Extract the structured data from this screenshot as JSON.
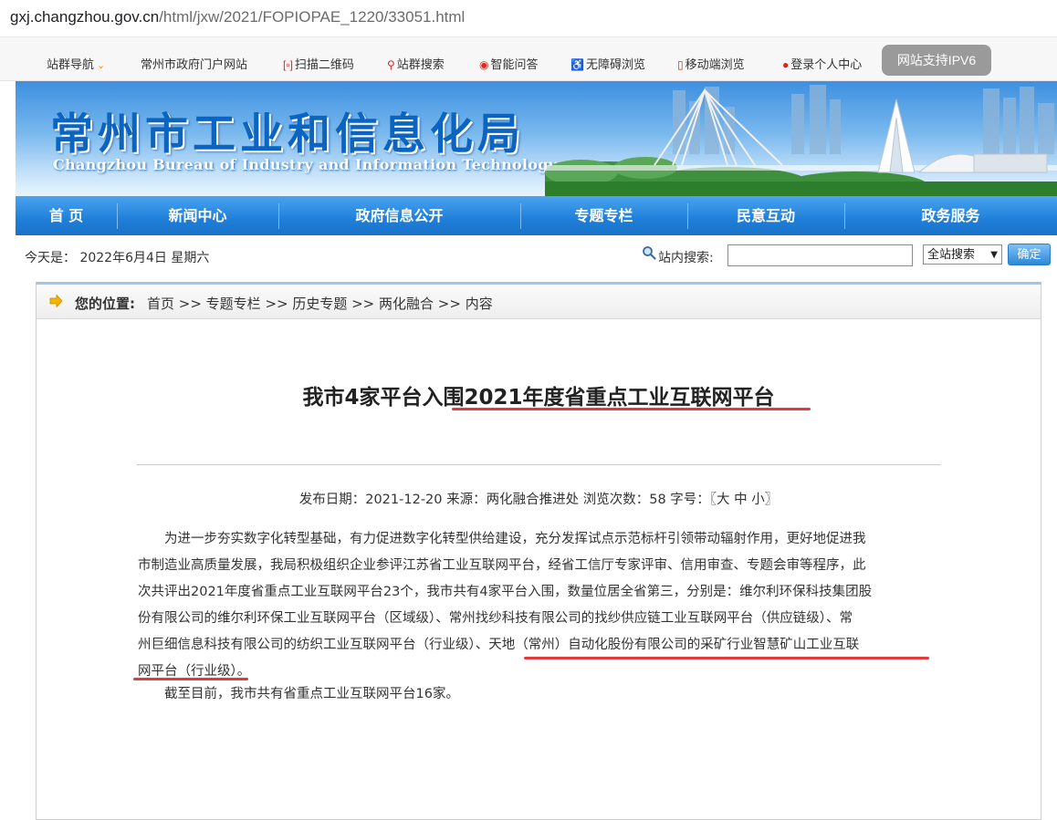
{
  "browser": {
    "url_host": "gxj.changzhou.gov.cn",
    "url_path": "/html/jxw/2021/FOPIOPAE_1220/33051.html"
  },
  "topbar": {
    "items": [
      {
        "label": "站群导航",
        "icon": "chevron-down"
      },
      {
        "label": "常州市政府门户网站",
        "icon": ""
      },
      {
        "label": "扫描二维码",
        "icon": "qr-icon"
      },
      {
        "label": "站群搜索",
        "icon": "search-icon"
      },
      {
        "label": "智能问答",
        "icon": "robot-icon"
      },
      {
        "label": "无障碍浏览",
        "icon": "accessibility-icon"
      },
      {
        "label": "移动端浏览",
        "icon": "mobile-icon"
      },
      {
        "label": "登录个人中心",
        "icon": "user-icon"
      }
    ],
    "ipv6_badge": "网站支持IPV6"
  },
  "header": {
    "title": "常州市工业和信息化局",
    "subtitle": "Changzhou Bureau of Industry and Information Technology"
  },
  "nav": {
    "items": [
      "首 页",
      "新闻中心",
      "政府信息公开",
      "专题专栏",
      "民意互动",
      "政务服务"
    ]
  },
  "date_row": {
    "today": "今天是： 2022年6月4日 星期六",
    "search_label": "站内搜索:",
    "search_value": "",
    "scope_selected": "全站搜索",
    "confirm_label": "确定"
  },
  "breadcrumb": {
    "label": "您的位置:",
    "path": "首页 >> 专题专栏 >> 历史专题 >> 两化融合 >> 内容"
  },
  "article": {
    "title": "我市4家平台入围2021年度省重点工业互联网平台",
    "meta": "发布日期：2021-12-20  来源：两化融合推进处  浏览次数：58  字号：〖大 中 小〗",
    "p1_l1": "为进一步夯实数字化转型基础，有力促进数字化转型供给建设，充分发挥试点示范标杆引领带动辐射作用，更好地促进我",
    "p1_l2": "市制造业高质量发展，我局积极组织企业参评江苏省工业互联网平台，经省工信厅专家评审、信用审查、专题会审等程序，此",
    "p1_l3": "次共评出2021年度省重点工业互联网平台23个，我市共有4家平台入围，数量位居全省第三，分别是：维尔利环保科技集团股",
    "p1_l4": "份有限公司的维尔利环保工业互联网平台（区域级）、常州找纱科技有限公司的找纱供应链工业互联网平台（供应链级）、常",
    "p1_l5": "州巨细信息科技有限公司的纺织工业互联网平台（行业级）、天地（常州）自动化股份有限公司的采矿行业智慧矿山工业互联",
    "p1_l6": "网平台（行业级）。",
    "p2": "截至目前，我市共有省重点工业互联网平台16家。"
  },
  "colors": {
    "nav_blue": "#1f7fd8",
    "title_blue": "#0b64c0",
    "annotation_red": "#e03a3a"
  }
}
